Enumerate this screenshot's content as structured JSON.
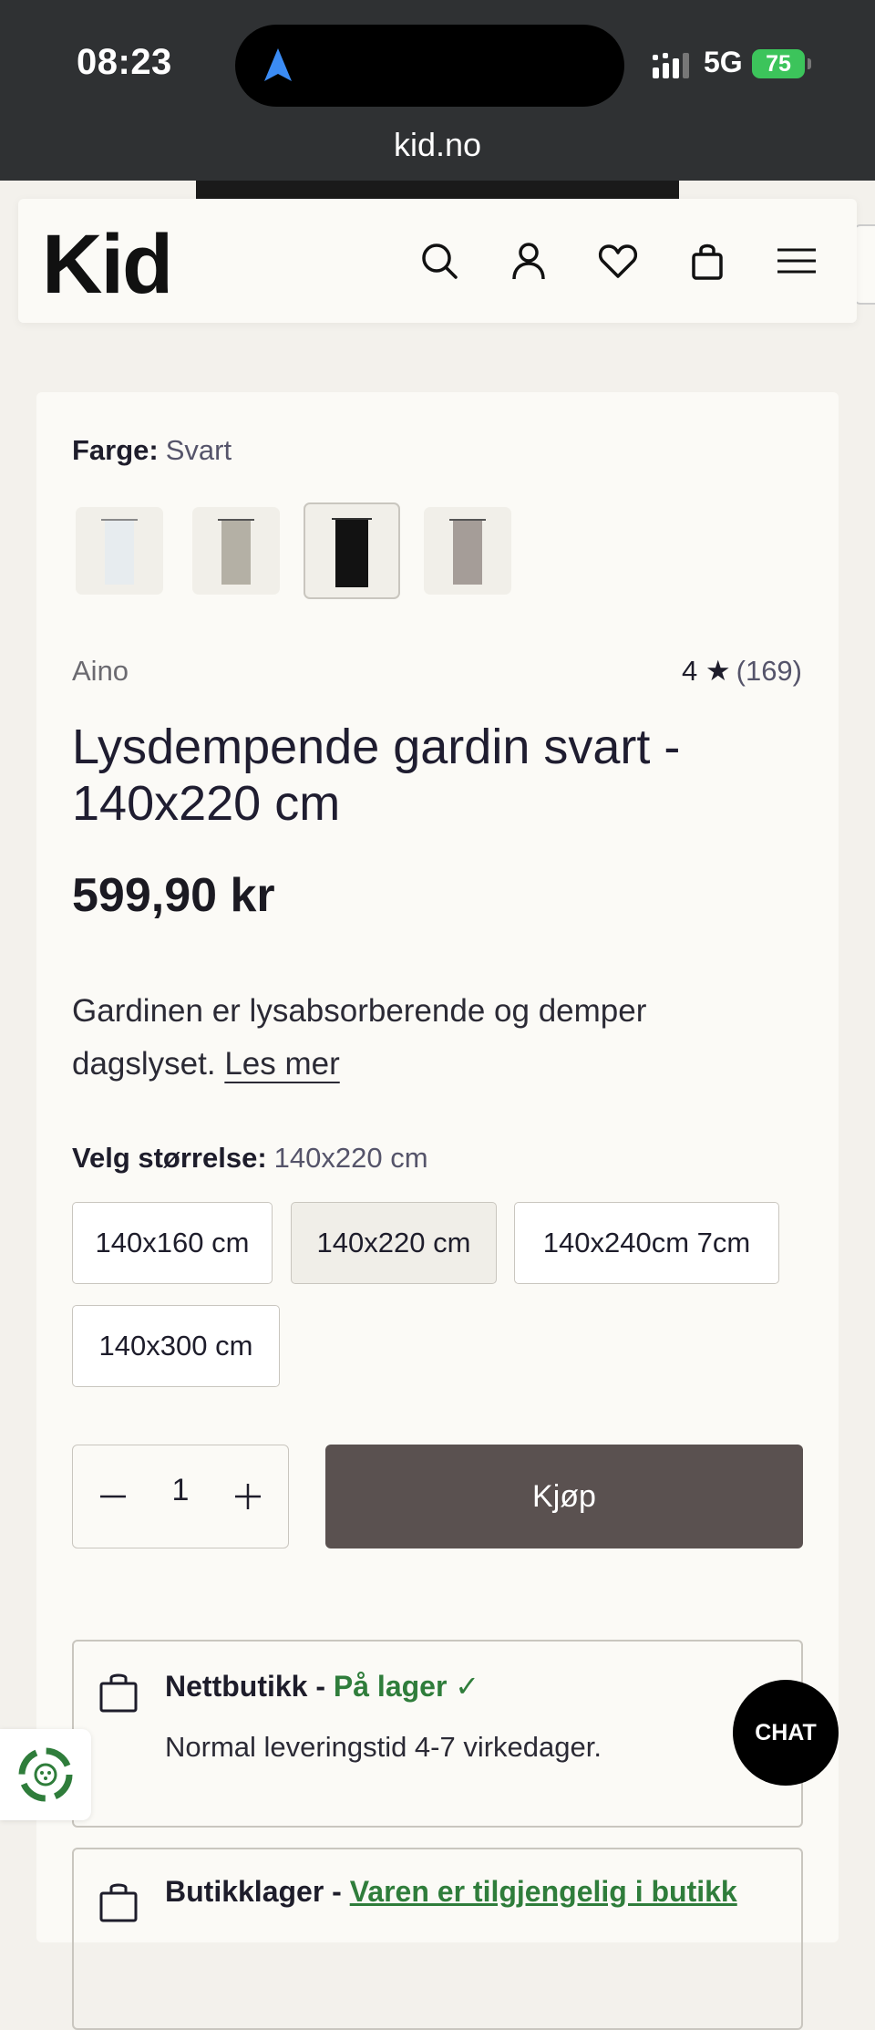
{
  "status_bar": {
    "time": "08:23",
    "network": "5G",
    "battery": "75"
  },
  "browser": {
    "url": "kid.no"
  },
  "header": {
    "logo": "Kid",
    "icons": [
      "search-icon",
      "account-icon",
      "heart-icon",
      "bag-icon",
      "menu-icon"
    ]
  },
  "product": {
    "color_label": "Farge:",
    "color_value": "Svart",
    "swatches": [
      {
        "name": "white",
        "color": "#e7ecef",
        "selected": false
      },
      {
        "name": "beige",
        "color": "#b4b0a5",
        "selected": false
      },
      {
        "name": "black",
        "color": "#121212",
        "selected": true
      },
      {
        "name": "greige",
        "color": "#a59d98",
        "selected": false
      }
    ],
    "brand": "Aino",
    "rating": "4 ★",
    "review_count": "(169)",
    "title": "Lysdempende gardin svart - 140x220 cm",
    "price": "599,90 kr",
    "description": "Gardinen er lysabsorberende og demper dagslyset.",
    "read_more": "Les mer",
    "size_label": "Velg størrelse:",
    "size_value": "140x220 cm",
    "sizes": [
      {
        "label": "140x160 cm",
        "selected": false
      },
      {
        "label": "140x220 cm",
        "selected": true
      },
      {
        "label": "140x240cm 7cm",
        "selected": false
      },
      {
        "label": "140x300 cm",
        "selected": false
      }
    ],
    "quantity": "1",
    "buy_label": "Kjøp"
  },
  "availability": {
    "online_label": "Nettbutikk -",
    "online_status": "På lager ✓",
    "online_delivery": "Normal leveringstid 4-7 virkedager.",
    "store_label": "Butikklager -",
    "store_status": "Varen er tilgjengelig i butikk"
  },
  "chat": {
    "label": "CHAT"
  },
  "colors": {
    "status_bar": "#2f3133",
    "page_bg": "#f3f1ec",
    "card_bg": "#fbfaf6",
    "buy_button": "#5a5150",
    "in_stock": "#2f7d3b"
  }
}
